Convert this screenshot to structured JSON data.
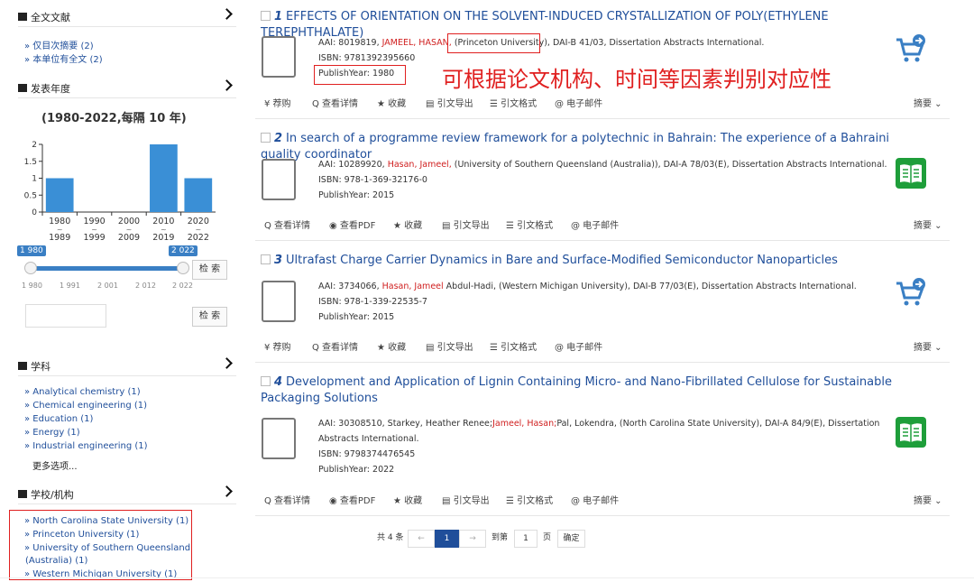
{
  "sidebar": {
    "fulltext": {
      "title": "全文文献",
      "links": [
        {
          "label": "» 仅目次摘要",
          "count": "(2)"
        },
        {
          "label": "» 本单位有全文",
          "count": "(2)"
        }
      ]
    },
    "years": {
      "title": "发表年度",
      "subtitle": "(1980-2022,每隔 10 年)",
      "range_start_badge": "1 980",
      "range_end_badge": "2 022",
      "scale_ticks": [
        "1 980",
        "1 991",
        "2 001",
        "2 012",
        "2 022"
      ],
      "search_label": "检 索",
      "search_label_2": "检 索"
    },
    "subjects": {
      "title": "学科",
      "items": [
        {
          "label": "» Analytical chemistry",
          "count": "(1)"
        },
        {
          "label": "» Chemical engineering",
          "count": "(1)"
        },
        {
          "label": "» Education",
          "count": "(1)"
        },
        {
          "label": "» Energy",
          "count": "(1)"
        },
        {
          "label": "» Industrial engineering",
          "count": "(1)"
        }
      ],
      "more": "更多选项..."
    },
    "institutions": {
      "title": "学校/机构",
      "items": [
        {
          "label": "» North Carolina State University",
          "count": "(1)"
        },
        {
          "label": "» Princeton University",
          "count": "(1)"
        },
        {
          "label": "» University of Southern Queensland",
          "line2": "(Australia)",
          "count": "(1)"
        },
        {
          "label": "» Western Michigan University",
          "count": "(1)"
        }
      ]
    }
  },
  "chart_data": {
    "type": "bar",
    "categories": [
      "1980\n~\n1989",
      "1990\n~\n1999",
      "2000\n~\n2009",
      "2010\n~\n2019",
      "2020\n~\n2022"
    ],
    "category_top": [
      "1980",
      "1990",
      "2000",
      "2010",
      "2020"
    ],
    "category_bottom": [
      "1989",
      "1999",
      "2009",
      "2019",
      "2022"
    ],
    "values": [
      1,
      0,
      0,
      2,
      1
    ],
    "ylim": [
      0,
      2
    ],
    "yticks": [
      "0",
      "0.5",
      "1",
      "1.5",
      "2"
    ],
    "color": "#3a8fd6",
    "title": "",
    "xlabel": "",
    "ylabel": ""
  },
  "callout": "可根据论文机构、时间等因素判别对应性",
  "results": [
    {
      "num": "1",
      "title": "EFFECTS OF ORIENTATION ON THE SOLVENT-INDUCED CRYSTALLIZATION OF POLY(ETHYLENE TEREPHTHALATE)",
      "aai": "AAI: 8019819, ",
      "authors": "JAMEEL, HASAN,",
      "affil": "(Princeton University),",
      "rest": " DAI-B 41/03, Dissertation Abstracts International.",
      "isbn": "ISBN: 9781392395660",
      "year": "PublishYear: 1980",
      "icon": "cart-icon",
      "actions": [
        "¥ 荐购",
        "Q 查看详情",
        "★ 收藏",
        "▤ 引文导出",
        "☰ 引文格式",
        "@ 电子邮件"
      ],
      "abstract": "摘要 ⌄"
    },
    {
      "num": "2",
      "title": "In search of a programme review framework for a polytechnic in Bahrain: The experience of a Bahraini quality coordinator",
      "aai": "AAI: 10289920, ",
      "authors": "Hasan, Jameel,",
      "affil": " (University of Southern Queensland (Australia)),",
      "rest": " DAI-A 78/03(E), Dissertation Abstracts International.",
      "isbn": "ISBN: 978-1-369-32176-0",
      "year": "PublishYear: 2015",
      "icon": "book-icon",
      "actions": [
        "Q 查看详情",
        "◉ 查看PDF",
        "★ 收藏",
        "▤ 引文导出",
        "☰ 引文格式",
        "@ 电子邮件"
      ],
      "abstract": "摘要 ⌄"
    },
    {
      "num": "3",
      "title": "Ultrafast Charge Carrier Dynamics in Bare and Surface-Modified Semiconductor Nanoparticles",
      "aai": "AAI: 3734066, ",
      "authors": "Hasan, Jameel",
      "affil": " Abdul-Hadi, (Western Michigan University),",
      "rest": " DAI-B 77/03(E), Dissertation Abstracts International.",
      "isbn": "ISBN: 978-1-339-22535-7",
      "year": "PublishYear: 2015",
      "icon": "cart-icon",
      "actions": [
        "¥ 荐购",
        "Q 查看详情",
        "★ 收藏",
        "▤ 引文导出",
        "☰ 引文格式",
        "@ 电子邮件"
      ],
      "abstract": "摘要 ⌄"
    },
    {
      "num": "4",
      "title": "Development and Application of Lignin Containing Micro- and Nano-Fibrillated Cellulose for Sustainable Packaging Solutions",
      "aai": "AAI: 30308510, Starkey, Heather Renee;",
      "authors": "Jameel, Hasan;",
      "affil": "Pal, Lokendra, (North Carolina State University),",
      "rest": " DAI-A 84/9(E), Dissertation Abstracts International.",
      "isbn": "ISBN: 9798374476545",
      "year": "PublishYear: 2022",
      "icon": "book-icon",
      "actions": [
        "Q 查看详情",
        "◉ 查看PDF",
        "★ 收藏",
        "▤ 引文导出",
        "☰ 引文格式",
        "@ 电子邮件"
      ],
      "abstract": "摘要 ⌄"
    }
  ],
  "pager": {
    "total": "共 4 条",
    "prev": "←",
    "current": "1",
    "next": "→",
    "goto": "到第",
    "page_value": "1",
    "page_unit": "页",
    "confirm": "确定"
  },
  "colors": {
    "link": "#1f4e9a",
    "highlight": "#d02020",
    "accent": "#3a7fc4",
    "pdf": "#1e9e3a"
  }
}
